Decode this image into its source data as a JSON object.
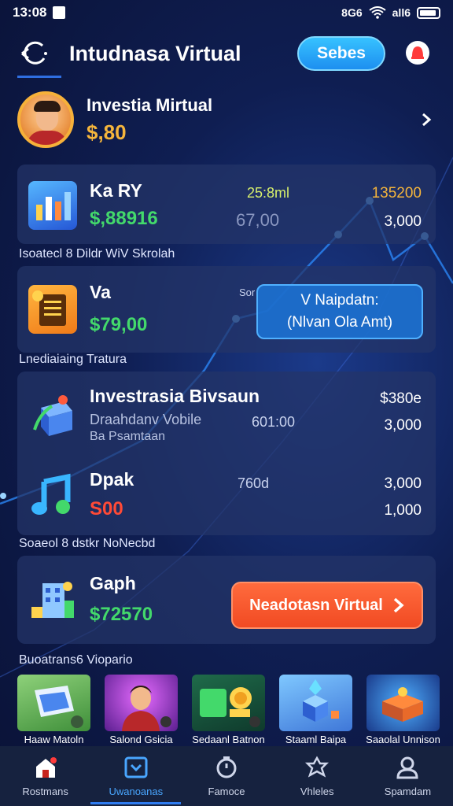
{
  "status_bar": {
    "time": "13:08",
    "right_text": "8G6",
    "signal_text": "all6"
  },
  "header": {
    "title": "Intudnasa Virtual",
    "pill_button": "Sebes"
  },
  "profile": {
    "name": "Investia Mirtual",
    "amount": "$,80"
  },
  "cards": [
    {
      "title": "Ka RY",
      "amount": "$,88916",
      "mid": "25:8ml",
      "mid_bottom": "67,00",
      "right_top": "135200",
      "right_bottom": "3,000",
      "icon": "bar-chart-icon"
    },
    {
      "title": "Va",
      "amount": "$79,00",
      "mid": "Sor",
      "icon": "document-icon"
    }
  ],
  "section_labels": {
    "one": "Isoatecl 8 Dildr WiV Skrolah",
    "two": "Lnediaiaing Tratura",
    "three": "Soaeol 8 dstkr NoNecbd",
    "four": "Buoatrans6 Viopario"
  },
  "tooltip": {
    "line1": "V Naipdatn:",
    "line2": "(Nlvan Ola Amt)"
  },
  "list": [
    {
      "title": "Investrasia Bivsaun",
      "sub1": "Draahdanv Vobile",
      "sub2": "Ba Psamtaan",
      "mid": "601:00",
      "right_top": "$380e",
      "right_bottom": "3,000",
      "icon": "box-icon"
    },
    {
      "title": "Dpak",
      "amount": "S00",
      "mid": "760d",
      "right_top": "3,000",
      "right_bottom": "1,000",
      "icon": "music-note-icon"
    }
  ],
  "graph_row": {
    "title": "Gaph",
    "amount": "$72570",
    "cta": "Neadotasn Virtual"
  },
  "thumbnails": [
    {
      "label": "Haaw Matoln",
      "icon": "laptop-icon"
    },
    {
      "label": "Salond Gsicia",
      "icon": "person-icon"
    },
    {
      "label": "Sedaanl Batnon",
      "icon": "coin-icon"
    },
    {
      "label": "Staaml Baipa",
      "icon": "diamond-icon"
    },
    {
      "label": "Saaolal Unnison",
      "icon": "chest-icon"
    }
  ],
  "nav": [
    {
      "label": "Rostmans",
      "icon": "home-icon"
    },
    {
      "label": "Uwanoanas",
      "icon": "wallet-icon"
    },
    {
      "label": "Famoce",
      "icon": "timer-icon"
    },
    {
      "label": "Vhleles",
      "icon": "badge-icon"
    },
    {
      "label": "Spamdam",
      "icon": "user-icon"
    }
  ],
  "colors": {
    "accent_blue": "#2f7cf0",
    "cta_orange": "#f14a23",
    "money_green": "#43d96b",
    "gold": "#f5b53c"
  }
}
